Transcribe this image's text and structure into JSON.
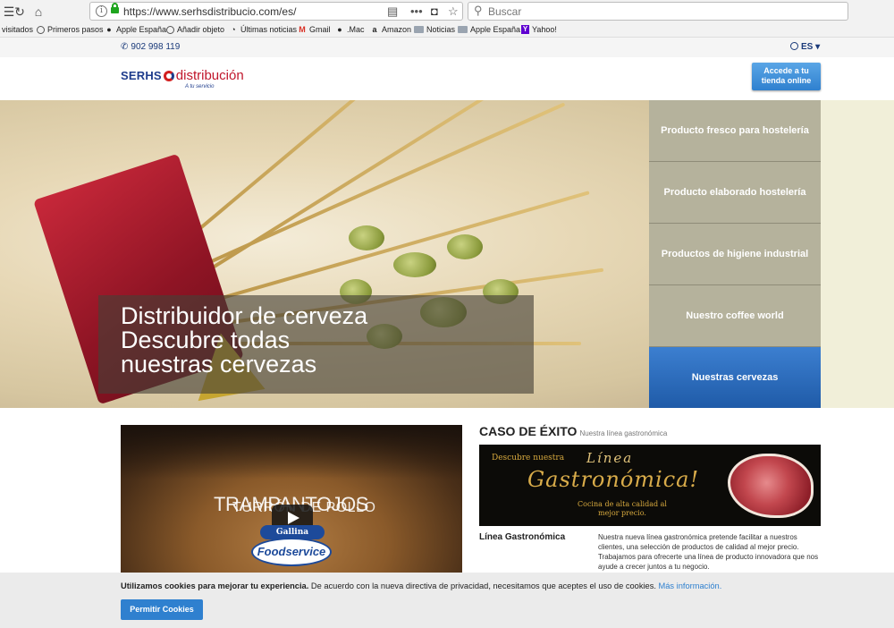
{
  "browser": {
    "url": "https://www.serhsdistribucio.com/es/",
    "search_placeholder": "Buscar",
    "bookmarks": [
      {
        "label": "visitados"
      },
      {
        "label": "Primeros pasos"
      },
      {
        "label": "Apple España"
      },
      {
        "label": "Añadir objeto"
      },
      {
        "label": "Últimas noticias"
      },
      {
        "label": "Gmail"
      },
      {
        "label": ".Mac"
      },
      {
        "label": "Amazon"
      },
      {
        "label": "Noticias"
      },
      {
        "label": "Apple España"
      },
      {
        "label": "Yahoo!"
      }
    ]
  },
  "site": {
    "phone": "902 998 119",
    "language": "ES",
    "logo": {
      "brand": "SERHS",
      "name": "distribución",
      "tagline": "A tu servicio"
    },
    "cta_line1": "Accede a tu",
    "cta_line2": "tienda online"
  },
  "hero": {
    "line1": "Distribuidor de cerveza",
    "line2": "Descubre todas",
    "line3": "nuestras cervezas",
    "menu": [
      {
        "label": "Producto fresco para hostelería",
        "active": false
      },
      {
        "label": "Producto elaborado hostelería",
        "active": false
      },
      {
        "label": "Productos de higiene industrial",
        "active": false
      },
      {
        "label": "Nuestro coffee world",
        "active": false
      },
      {
        "label": "Nuestras cervezas",
        "active": true
      }
    ]
  },
  "video": {
    "title": "TRAMPANTOJOS",
    "subtitle": "TURRÓN DE POLLO",
    "brand1": "Gallina Blanca",
    "brand2": "Foodservice"
  },
  "case_study": {
    "title": "CASO DE ÉXITO",
    "subtitle": "Nuestra línea gastronómica",
    "banner_line1": "Descubre nuestra",
    "banner_line2": "Línea",
    "banner_line3": "Gastronómica!",
    "banner_line4": "Cocina de alta calidad al mejor precio.",
    "label": "Línea Gastronómica",
    "text": "Nuestra nueva línea gastronómica pretende facilitar a nuestros clientes, una selección de productos de calidad al mejor precio. Trabajamos para ofrecerte una línea de producto innovadora que nos ayude a crecer juntos a tu negocio."
  },
  "cookies": {
    "bold": "Utilizamos cookies para mejorar tu experiencia.",
    "text": " De acuerdo con la nueva directiva de privacidad, necesitamos que aceptes el uso de cookies. ",
    "link": "Más información.",
    "button": "Permitir Cookies"
  },
  "colors": {
    "accent_blue": "#2f80cf",
    "brand_red": "#c0162b",
    "brand_navy": "#1e3c8c",
    "menu_olive": "#b5b29c"
  }
}
